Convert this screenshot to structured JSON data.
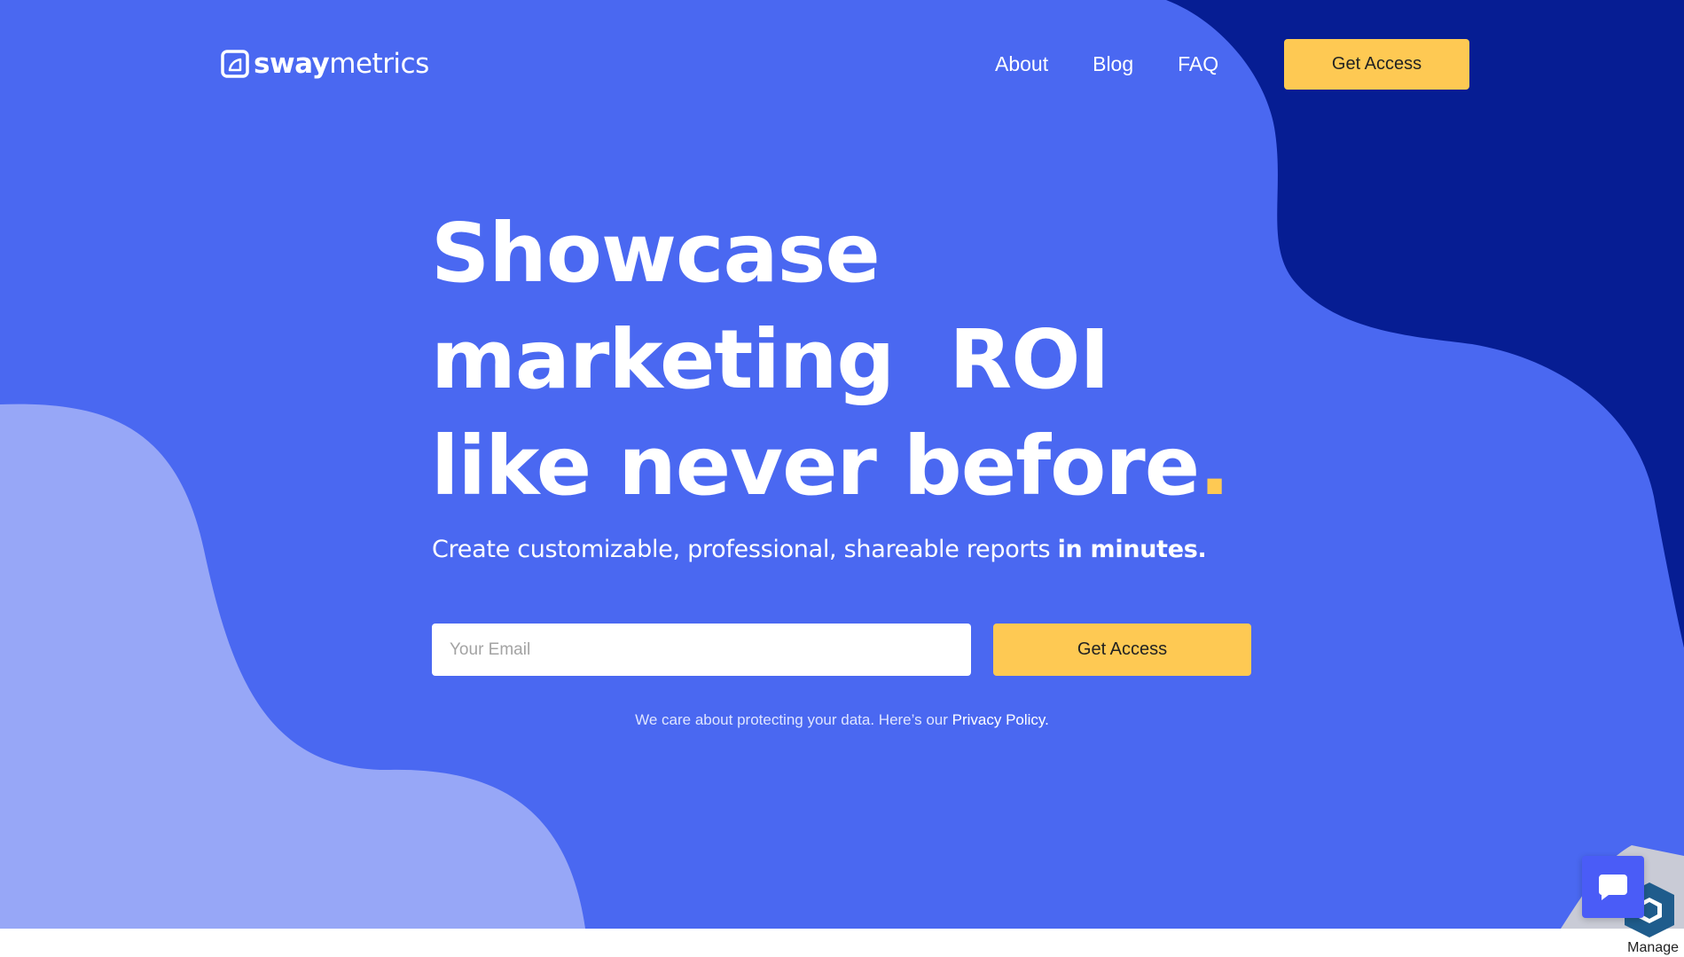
{
  "brand": {
    "name_bold": "sway",
    "name_light": "metrics"
  },
  "nav": {
    "items": [
      {
        "label": "About"
      },
      {
        "label": "Blog"
      },
      {
        "label": "FAQ"
      }
    ],
    "cta_label": "Get Access"
  },
  "hero": {
    "headline_line1": "Showcase",
    "headline_line2": "marketing  ROI",
    "headline_line3": "like never before",
    "headline_dot": ".",
    "subhead_text": "Create customizable, professional, shareable reports ",
    "subhead_emphasis": "in minutes.",
    "email_placeholder": "Your Email",
    "email_value": "",
    "cta_label": "Get Access",
    "privacy_text": "We care about protecting your data. Here’s our ",
    "privacy_link": "Privacy Policy."
  },
  "widgets": {
    "chat_icon": "chat-bubble-icon",
    "manage_icon": "hexagon-icon",
    "manage_label": "Manage"
  },
  "colors": {
    "hero_background": "#4a68f1",
    "dark_blob": "#061d93",
    "light_blob": "#97a7f7",
    "accent_yellow": "#fec953",
    "chat_button": "#4a5cf7"
  }
}
